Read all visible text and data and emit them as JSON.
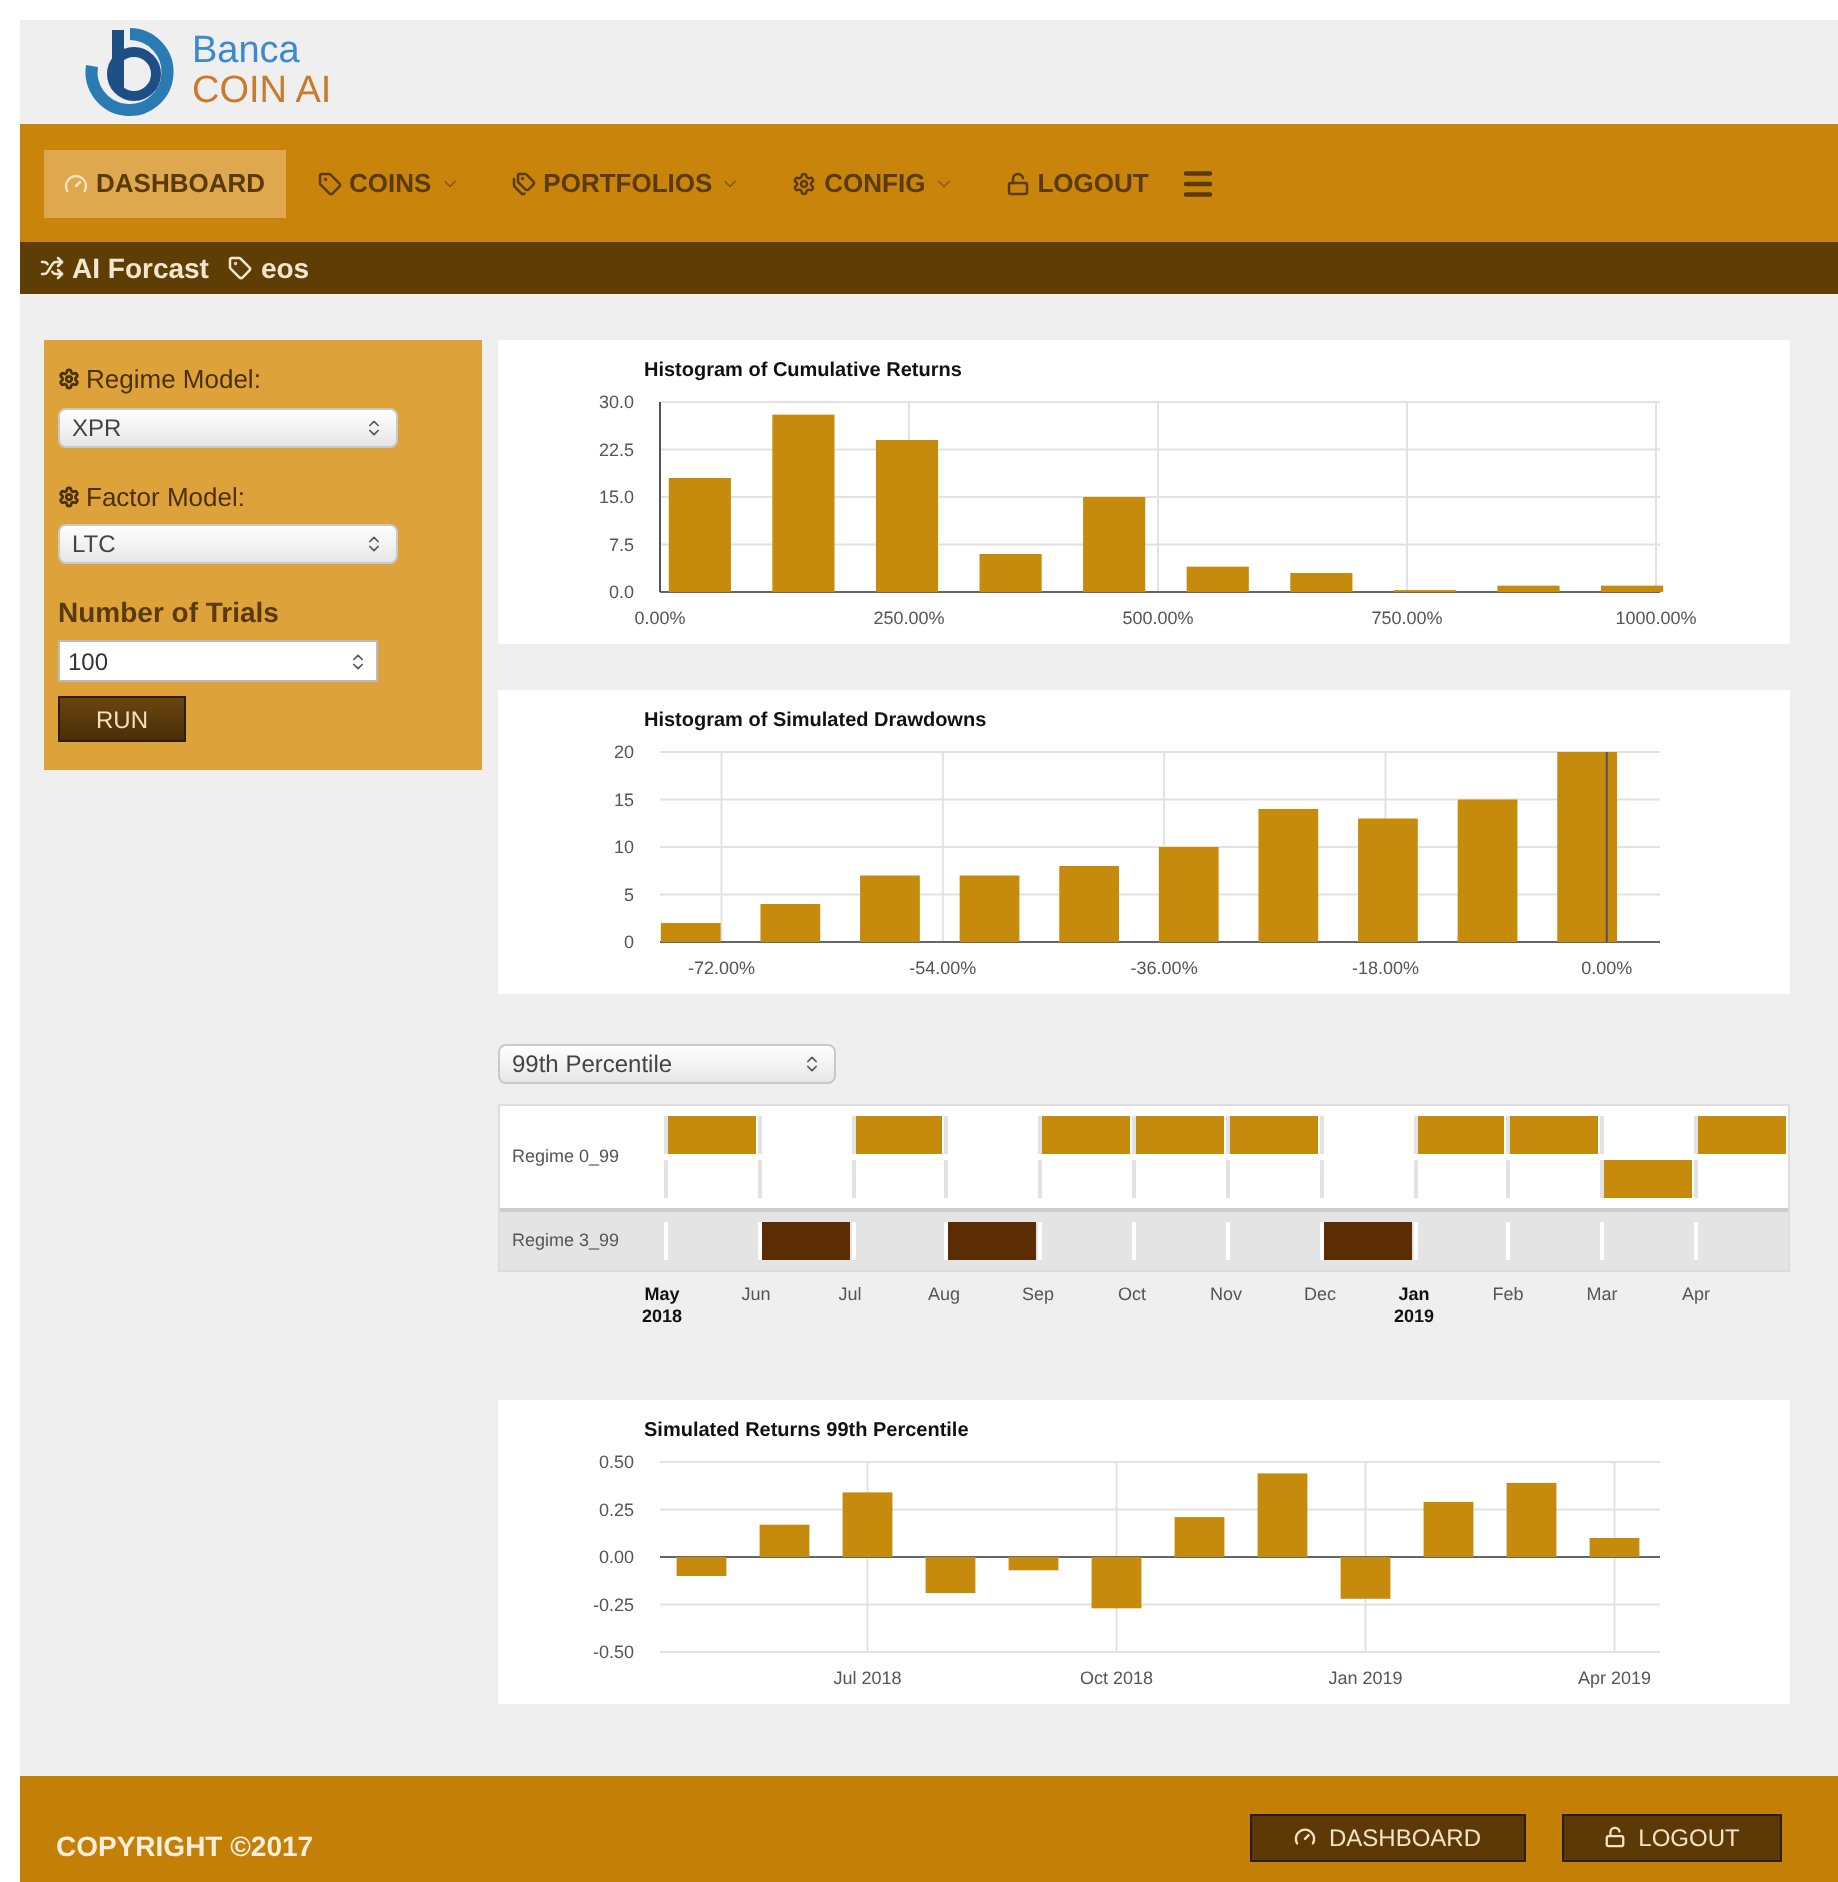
{
  "brand": {
    "line_1": "Banca",
    "line_2": "COIN AI"
  },
  "nav": [
    {
      "label": "DASHBOARD",
      "kind": "gauge",
      "dropdown": false,
      "selected": true
    },
    {
      "label": "COINS",
      "kind": "tag",
      "dropdown": true,
      "selected": false
    },
    {
      "label": "PORTFOLIOS",
      "kind": "tags",
      "dropdown": true,
      "selected": false
    },
    {
      "label": "CONFIG",
      "kind": "cog",
      "dropdown": true,
      "selected": false
    },
    {
      "label": "LOGOUT",
      "kind": "unlock",
      "dropdown": false,
      "selected": false
    }
  ],
  "breadcrumb": [
    {
      "label": "AI Forcast",
      "kind": "shuffle"
    },
    {
      "label": "eos",
      "kind": "tag"
    }
  ],
  "form": {
    "regime_label": "Regime Model:",
    "regime_value": "XPR",
    "factor_label": "Factor Model:",
    "factor_value": "LTC",
    "trials_label": "Number of Trials",
    "trials_value": "100",
    "run": "RUN"
  },
  "charts": [
    {
      "chart_data": {
        "type": "bar",
        "title": "Histogram of Cumulative Returns",
        "grid": true,
        "x": [
          40,
          144,
          248,
          352,
          456,
          560,
          664,
          768,
          872,
          976
        ],
        "values": [
          18,
          28,
          24,
          6,
          15,
          4,
          3,
          0.3,
          1,
          1
        ],
        "color": "#c68a0c",
        "xlim": [
          0,
          1000
        ],
        "ylim": [
          0,
          30
        ],
        "xticks": [
          {
            "value": 0,
            "label": "0.00%"
          },
          {
            "value": 250,
            "label": "250.00%"
          },
          {
            "value": 500,
            "label": "500.00%"
          },
          {
            "value": 750,
            "label": "750.00%"
          },
          {
            "value": 1000,
            "label": "1000.00%"
          }
        ],
        "yticks": [
          {
            "value": 0,
            "label": "0.0"
          },
          {
            "value": 7.5,
            "label": "7.5"
          },
          {
            "value": 15,
            "label": "15.0"
          },
          {
            "value": 22.5,
            "label": "22.5"
          },
          {
            "value": 30,
            "label": "30.0"
          }
        ]
      }
    },
    {
      "chart_data": {
        "type": "bar",
        "title": "Histogram of Simulated Drawdowns",
        "grid": true,
        "x": [
          -74.5,
          -66.4,
          -58.3,
          -50.2,
          -42.1,
          -34,
          -25.9,
          -17.8,
          -9.7,
          -1.6
        ],
        "values": [
          2,
          4,
          7,
          7,
          8,
          10,
          14,
          13,
          15,
          20
        ],
        "color": "#c68a0c",
        "xlim": [
          -77,
          4
        ],
        "ylim": [
          0,
          20
        ],
        "xticks": [
          {
            "value": -72,
            "label": "-72.00%"
          },
          {
            "value": -54,
            "label": "-54.00%"
          },
          {
            "value": -36,
            "label": "-36.00%"
          },
          {
            "value": -18,
            "label": "-18.00%"
          },
          {
            "value": 0,
            "label": "0.00%"
          }
        ],
        "yticks": [
          0,
          5,
          10,
          15,
          20
        ]
      }
    }
  ],
  "percentile_select": "99th Percentile",
  "timeline": {
    "months": [
      {
        "label": "May",
        "year": "2018"
      },
      {
        "label": "Jun"
      },
      {
        "label": "Jul"
      },
      {
        "label": "Aug"
      },
      {
        "label": "Sep"
      },
      {
        "label": "Oct"
      },
      {
        "label": "Nov"
      },
      {
        "label": "Dec"
      },
      {
        "label": "Jan",
        "year": "2019"
      },
      {
        "label": "Feb"
      },
      {
        "label": "Mar"
      },
      {
        "label": "Apr"
      }
    ],
    "rows": [
      {
        "label": "Regime 0_99",
        "color": "#c68a0c",
        "lanes": [
          [
            true,
            false,
            true,
            false,
            true,
            true,
            true,
            false,
            true,
            true,
            false,
            true
          ],
          [
            false,
            false,
            false,
            false,
            false,
            false,
            false,
            false,
            false,
            false,
            true,
            false
          ]
        ]
      },
      {
        "label": "Regime 3_99",
        "color": "#5c2c05",
        "lanes": [
          [
            false,
            true,
            false,
            true,
            false,
            false,
            false,
            true,
            false,
            false,
            false,
            false
          ]
        ]
      }
    ]
  },
  "returns_chart": {
    "chart_data": {
      "type": "bar",
      "title": "Simulated Returns 99th Percentile",
      "grid": true,
      "categories": [
        null,
        null,
        "Jul 2018",
        null,
        null,
        "Oct 2018",
        null,
        null,
        "Jan 2019",
        null,
        null,
        "Apr 2019"
      ],
      "values": [
        -0.1,
        0.17,
        0.34,
        -0.19,
        -0.07,
        -0.27,
        0.21,
        0.44,
        -0.22,
        0.29,
        0.39,
        0.1
      ],
      "color": "#c68a0c",
      "ylim": [
        -0.5,
        0.5
      ],
      "yticks": [
        {
          "value": -0.5,
          "label": "-0.50"
        },
        {
          "value": -0.25,
          "label": "-0.25"
        },
        {
          "value": 0,
          "label": "0.00"
        },
        {
          "value": 0.25,
          "label": "0.25"
        },
        {
          "value": 0.5,
          "label": "0.50"
        }
      ]
    }
  },
  "footer": {
    "copyright": "COPYRIGHT ©2017",
    "buttons": [
      {
        "label": "DASHBOARD",
        "kind": "gauge"
      },
      {
        "label": "LOGOUT",
        "kind": "unlock"
      }
    ]
  }
}
